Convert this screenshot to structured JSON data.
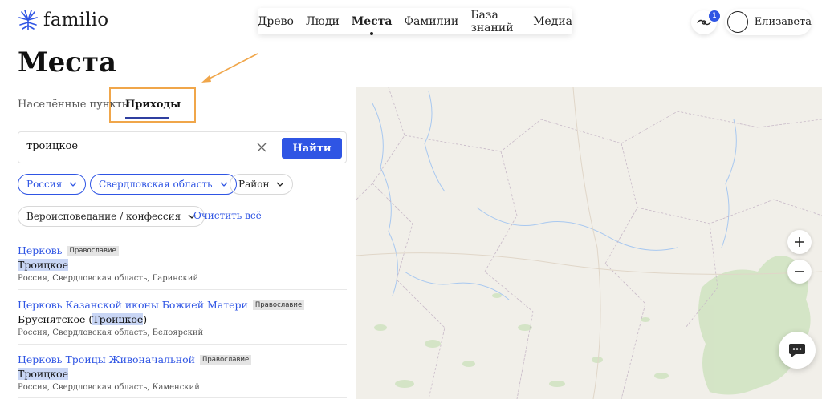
{
  "header": {
    "logo_text": "familio",
    "nav": [
      "Древо",
      "Люди",
      "Места",
      "Фамилии",
      "База знаний",
      "Медиа"
    ],
    "active_nav": "Места",
    "notification_count": "1",
    "user_name": "Елизавета"
  },
  "page": {
    "title": "Места"
  },
  "tabs": {
    "settlements": "Населённые пункты",
    "parishes": "Приходы",
    "active": "Приходы"
  },
  "search": {
    "value": "троицкое",
    "button_label": "Найти"
  },
  "filters": {
    "country": "Россия",
    "region": "Свердловская область",
    "district": "Район",
    "confession": "Вероисповедание / конфессия",
    "clear_all": "Очистить всё"
  },
  "results": [
    {
      "title": "Церковь",
      "tag": "Православие",
      "name_pre": "",
      "name_hl": "Троицкое",
      "name_post": "",
      "location": "Россия, Свердловская область, Гаринский"
    },
    {
      "title": "Церковь Казанской иконы Божией Матери",
      "tag": "Православие",
      "name_pre": "Бруснятское (",
      "name_hl": "Троицкое",
      "name_post": ")",
      "location": "Россия, Свердловская область, Белоярский"
    },
    {
      "title": "Церковь Троицы Живоначальной",
      "tag": "Православие",
      "name_pre": "",
      "name_hl": "Троицкое",
      "name_post": "",
      "location": "Россия, Свердловская область, Каменский"
    }
  ],
  "map": {
    "zoom_in_icon": "plus-icon",
    "zoom_out_icon": "minus-icon",
    "chat_icon": "chat-icon",
    "land_color": "#f1efe9",
    "forest_color": "#cfe3c0",
    "water_color": "#a8c8f0"
  },
  "colors": {
    "accent": "#2f55e4",
    "annotation": "#f0a64a"
  }
}
